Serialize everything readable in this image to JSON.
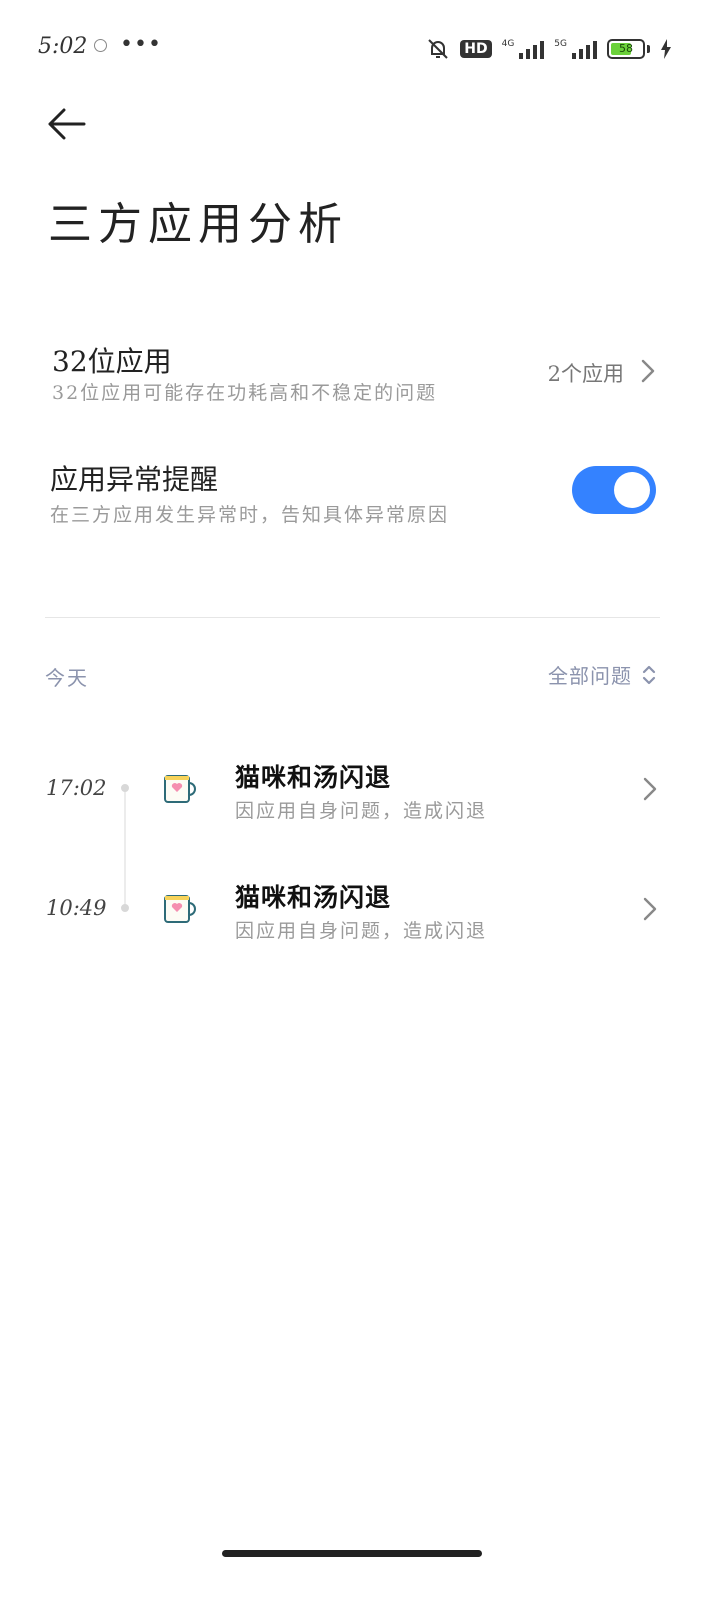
{
  "status_bar": {
    "time": "5:02",
    "more": "•••",
    "hd": "HD",
    "net1": "4G",
    "net2": "5G",
    "battery": "58"
  },
  "header": {
    "title": "三方应用分析"
  },
  "settings": {
    "app32": {
      "title": "32位应用",
      "subtitle": "32位应用可能存在功耗高和不稳定的问题",
      "value": "2个应用"
    },
    "abnormal_reminder": {
      "title": "应用异常提醒",
      "subtitle": "在三方应用发生异常时，告知具体异常原因",
      "enabled": true
    }
  },
  "events": {
    "day_label": "今天",
    "filter_label": "全部问题",
    "items": [
      {
        "time": "17:02",
        "title": "猫咪和汤闪退",
        "subtitle": "因应用自身问题，造成闪退"
      },
      {
        "time": "10:49",
        "title": "猫咪和汤闪退",
        "subtitle": "因应用自身问题，造成闪退"
      }
    ]
  },
  "colors": {
    "accent": "#3482ff",
    "muted_text": "#9a9a9a",
    "label_blue_gray": "#8b93ad"
  }
}
